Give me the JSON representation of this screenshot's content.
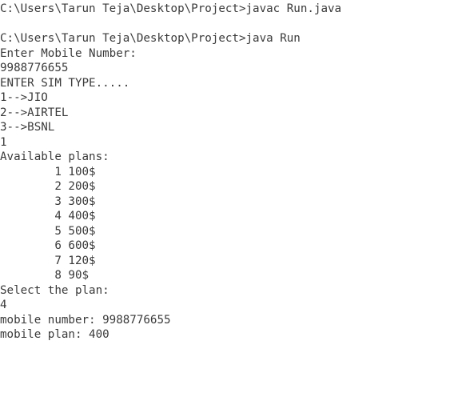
{
  "terminal": {
    "lines": [
      "C:\\Users\\Tarun Teja\\Desktop\\Project>javac Run.java",
      "",
      "C:\\Users\\Tarun Teja\\Desktop\\Project>java Run",
      "Enter Mobile Number:",
      "9988776655",
      "ENTER SIM TYPE.....",
      "1-->JIO",
      "2-->AIRTEL",
      "3-->BSNL",
      "1",
      "Available plans:",
      "        1 100$",
      "        2 200$",
      "        3 300$",
      "        4 400$",
      "        5 500$",
      "        6 600$",
      "        7 120$",
      "        8 90$",
      "Select the plan:",
      "4",
      "mobile number: 9988776655",
      "mobile plan: 400"
    ]
  }
}
